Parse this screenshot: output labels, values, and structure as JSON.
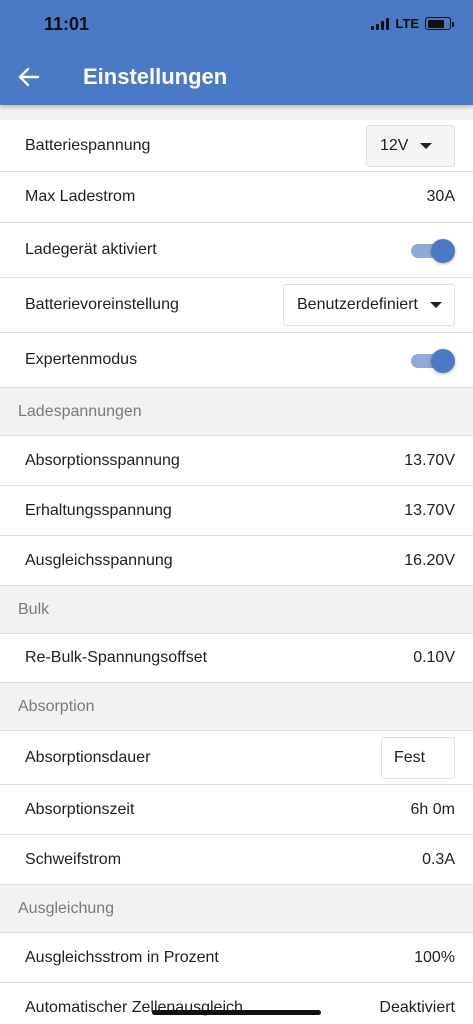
{
  "status_bar": {
    "time": "11:01",
    "network": "LTE"
  },
  "header": {
    "title": "Einstellungen",
    "back_icon": "arrow-left-icon",
    "color": "#4a79c6"
  },
  "rows_general": [
    {
      "label": "Batteriespannung",
      "value": "12V",
      "control": "dropdown"
    },
    {
      "label": "Max Ladestrom",
      "value": "30A",
      "control": "text"
    },
    {
      "label": "Ladegerät aktiviert",
      "value": "on",
      "control": "toggle"
    },
    {
      "label": "Batterievoreinstellung",
      "value": "Benutzerdefiniert",
      "control": "dropdown"
    },
    {
      "label": "Expertenmodus",
      "value": "on",
      "control": "toggle"
    }
  ],
  "sections": {
    "ladespannungen": "Ladespannungen",
    "bulk": "Bulk",
    "absorption": "Absorption",
    "ausgleichung": "Ausgleichung"
  },
  "ladespannungen_rows": [
    {
      "label": "Absorptionsspannung",
      "value": "13.70V"
    },
    {
      "label": "Erhaltungsspannung",
      "value": "13.70V"
    },
    {
      "label": "Ausgleichsspannung",
      "value": "16.20V"
    }
  ],
  "bulk_rows": [
    {
      "label": "Re-Bulk-Spannungsoffset",
      "value": "0.10V"
    }
  ],
  "absorption_rows": [
    {
      "label": "Absorptionsdauer",
      "value": "Fest"
    },
    {
      "label": "Absorptionszeit",
      "value": "6h 0m"
    },
    {
      "label": "Schweifstrom",
      "value": "0.3A"
    }
  ],
  "ausgleichung_rows": [
    {
      "label": "Ausgleichsstrom in Prozent",
      "value": "100%"
    },
    {
      "label": "Automatischer Zellenausgleich",
      "value": "Deaktiviert"
    }
  ]
}
